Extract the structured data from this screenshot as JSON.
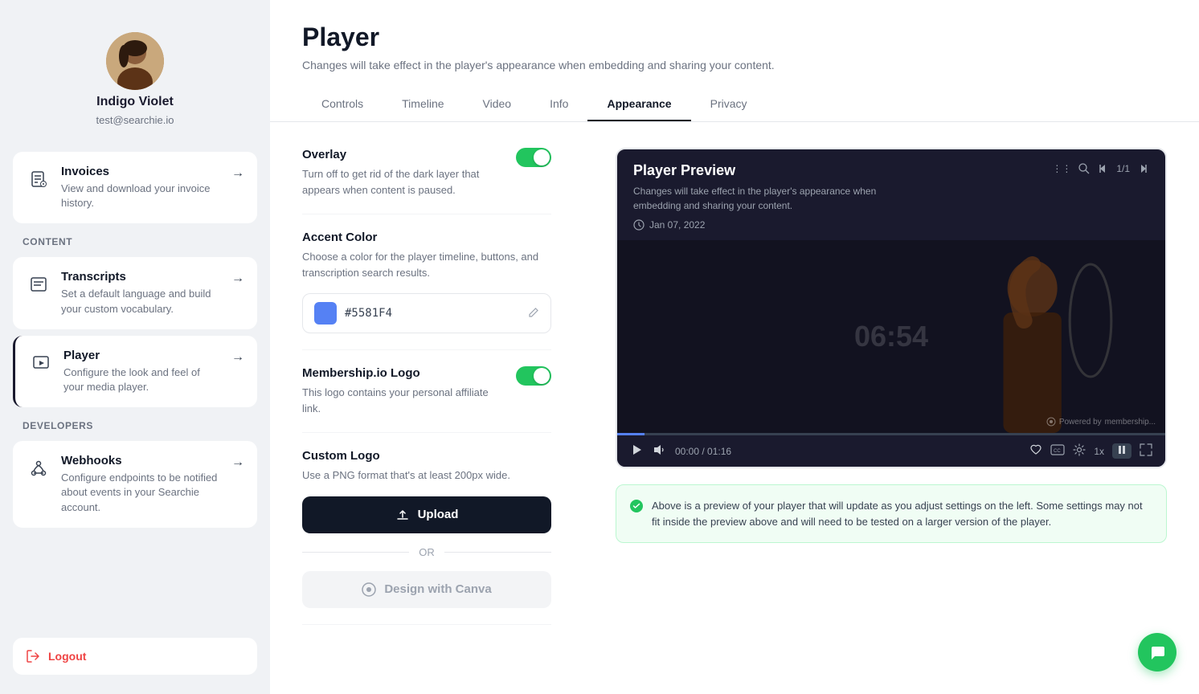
{
  "sidebar": {
    "profile": {
      "username": "Indigo Violet",
      "email": "test@searchie.io"
    },
    "sections": [
      {
        "label": "",
        "items": [
          {
            "id": "invoices",
            "title": "Invoices",
            "desc": "View and download your invoice history.",
            "icon": "invoice-icon",
            "active": false
          }
        ]
      },
      {
        "label": "Content",
        "items": [
          {
            "id": "transcripts",
            "title": "Transcripts",
            "desc": "Set a default language and build your custom vocabulary.",
            "icon": "transcript-icon",
            "active": false
          },
          {
            "id": "player",
            "title": "Player",
            "desc": "Configure the look and feel of your media player.",
            "icon": "player-icon",
            "active": true
          }
        ]
      },
      {
        "label": "Developers",
        "items": [
          {
            "id": "webhooks",
            "title": "Webhooks",
            "desc": "Configure endpoints to be notified about events in your Searchie account.",
            "icon": "webhook-icon",
            "active": false
          }
        ]
      }
    ],
    "logout_label": "Logout"
  },
  "main": {
    "title": "Player",
    "subtitle": "Changes will take effect in the player's appearance when embedding and sharing your content.",
    "tabs": [
      {
        "id": "controls",
        "label": "Controls",
        "active": false
      },
      {
        "id": "timeline",
        "label": "Timeline",
        "active": false
      },
      {
        "id": "video",
        "label": "Video",
        "active": false
      },
      {
        "id": "info",
        "label": "Info",
        "active": false
      },
      {
        "id": "appearance",
        "label": "Appearance",
        "active": true
      },
      {
        "id": "privacy",
        "label": "Privacy",
        "active": false
      }
    ]
  },
  "settings": {
    "overlay": {
      "title": "Overlay",
      "desc": "Turn off to get rid of the dark layer that appears when content is paused.",
      "enabled": true
    },
    "accent_color": {
      "title": "Accent Color",
      "desc": "Choose a color for the player timeline, buttons, and transcription search results.",
      "value": "#5581F4",
      "display": "#5581F4"
    },
    "membership_logo": {
      "title": "Membership.io Logo",
      "desc": "This logo contains your personal affiliate link.",
      "enabled": true
    },
    "custom_logo": {
      "title": "Custom Logo",
      "desc": "Use a PNG format that's at least 200px wide."
    },
    "upload_label": "Upload",
    "or_label": "OR",
    "canva_label": "Design with Canva"
  },
  "preview": {
    "title": "Player Preview",
    "subtitle": "Changes will take effect in the player's appearance when embedding and sharing your content.",
    "date": "Jan 07, 2022",
    "time_current": "00:00",
    "time_total": "01:16",
    "counter": "1/1",
    "speed": "1x",
    "timer_display": "06:54",
    "powered_by": "Powered by",
    "powered_by_brand": "membership...",
    "info_banner": "Above is a preview of your player that will update as you adjust settings on the left. Some settings may not fit inside the preview above and will need to be tested on a larger version of the player."
  }
}
